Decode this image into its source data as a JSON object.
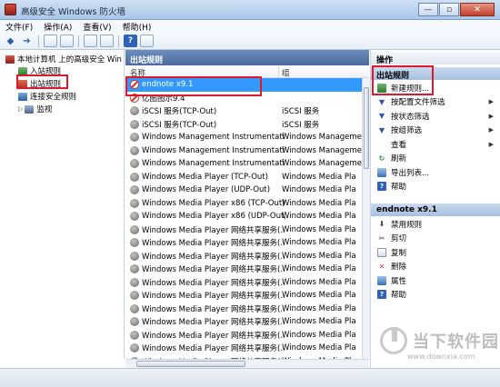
{
  "window": {
    "title": "高级安全 Windows 防火墙",
    "min_label": "—",
    "max_label": "▫",
    "close_label": "✕"
  },
  "menu": [
    "文件(F)",
    "操作(A)",
    "查看(V)",
    "帮助(H)"
  ],
  "toolbar": {
    "back_glyph": "◆",
    "forward_glyph": "➔",
    "help_glyph": "?"
  },
  "tree": {
    "root": "本地计算机 上的高级安全 Win",
    "items": [
      "入站规则",
      "出站规则",
      "连接安全规则",
      "监视"
    ]
  },
  "center": {
    "header": "出站规则",
    "columns": [
      "名称",
      "组"
    ],
    "rows": [
      {
        "name": "endnote x9.1",
        "group": "",
        "icon": "block",
        "selected": true
      },
      {
        "name": "亿图图示9.4",
        "group": "",
        "icon": "block",
        "selected": false
      },
      {
        "name": "iSCSI 服务(TCP-Out)",
        "group": "iSCSI 服务",
        "icon": "gray",
        "selected": false
      },
      {
        "name": "iSCSI 服务(TCP-Out)",
        "group": "iSCSI 服务",
        "icon": "gray",
        "selected": false
      },
      {
        "name": "Windows Management Instrumentati...",
        "group": "Windows Manageme",
        "icon": "gray",
        "selected": false
      },
      {
        "name": "Windows Management Instrumentati...",
        "group": "Windows Manageme",
        "icon": "gray",
        "selected": false
      },
      {
        "name": "Windows Management Instrumentati...",
        "group": "Windows Manageme",
        "icon": "gray",
        "selected": false
      },
      {
        "name": "Windows Media Player (TCP-Out)",
        "group": "Windows Media Pla",
        "icon": "gray",
        "selected": false
      },
      {
        "name": "Windows Media Player (UDP-Out)",
        "group": "Windows Media Pla",
        "icon": "gray",
        "selected": false
      },
      {
        "name": "Windows Media Player x86 (TCP-Out)",
        "group": "Windows Media Pla",
        "icon": "gray",
        "selected": false
      },
      {
        "name": "Windows Media Player x86 (UDP-Out)",
        "group": "Windows Media Pla",
        "icon": "gray",
        "selected": false
      },
      {
        "name": "Windows Media Player 网络共享服务(...",
        "group": "Windows Media Pla",
        "icon": "gray",
        "selected": false
      },
      {
        "name": "Windows Media Player 网络共享服务(...",
        "group": "Windows Media Pla",
        "icon": "gray",
        "selected": false
      },
      {
        "name": "Windows Media Player 网络共享服务(...",
        "group": "Windows Media Pla",
        "icon": "gray",
        "selected": false
      },
      {
        "name": "Windows Media Player 网络共享服务(...",
        "group": "Windows Media Pla",
        "icon": "gray",
        "selected": false
      },
      {
        "name": "Windows Media Player 网络共享服务(...",
        "group": "Windows Media Pla",
        "icon": "gray",
        "selected": false
      },
      {
        "name": "Windows Media Player 网络共享服务(...",
        "group": "Windows Media Pla",
        "icon": "gray",
        "selected": false
      },
      {
        "name": "Windows Media Player 网络共享服务(...",
        "group": "Windows Media Pla",
        "icon": "gray",
        "selected": false
      },
      {
        "name": "Windows Media Player 网络共享服务(...",
        "group": "Windows Media Pla",
        "icon": "gray",
        "selected": false
      },
      {
        "name": "Windows Media Player 网络共享服务(...",
        "group": "Windows Media Pla",
        "icon": "gray",
        "selected": false
      },
      {
        "name": "Windows Media Player 网络共享服务(...",
        "group": "Windows Media Pla",
        "icon": "gray",
        "selected": false
      },
      {
        "name": "Windows Media Player 网络共享服务(...",
        "group": "Windows Media Pla",
        "icon": "gray",
        "selected": false
      },
      {
        "name": "Windows Media Player 网络共享服务(...",
        "group": "Windows Media Pla",
        "icon": "gray",
        "selected": false
      }
    ]
  },
  "actions": {
    "header": "操作",
    "section1": "出站规则",
    "items1": [
      {
        "label": "新建规则...",
        "icon": "new",
        "arrow": false
      },
      {
        "label": "按配置文件筛选",
        "icon": "filter",
        "arrow": true
      },
      {
        "label": "按状态筛选",
        "icon": "filter",
        "arrow": true
      },
      {
        "label": "按组筛选",
        "icon": "filter",
        "arrow": true
      },
      {
        "label": "查看",
        "icon": "view",
        "arrow": true
      },
      {
        "label": "刷新",
        "icon": "refresh",
        "arrow": false
      },
      {
        "label": "导出列表...",
        "icon": "export",
        "arrow": false
      },
      {
        "label": "帮助",
        "icon": "help",
        "arrow": false
      }
    ],
    "section2": "endnote x9.1",
    "items2": [
      {
        "label": "禁用规则",
        "icon": "disable"
      },
      {
        "label": "剪切",
        "icon": "cut"
      },
      {
        "label": "复制",
        "icon": "copy"
      },
      {
        "label": "删除",
        "icon": "delete"
      },
      {
        "label": "属性",
        "icon": "props"
      },
      {
        "label": "帮助",
        "icon": "help"
      }
    ],
    "glyphs": {
      "filter": "▼",
      "refresh": "↻",
      "help": "?",
      "disable": "⬇",
      "cut": "✂",
      "delete": "✕",
      "arrow": "▶"
    }
  },
  "watermark": {
    "text": "当下软件园",
    "url": "www.downxia.com"
  },
  "colors": {
    "selection": "#3399ff",
    "highlight_box": "#e0182b",
    "center_header": "#4a6a9c"
  }
}
